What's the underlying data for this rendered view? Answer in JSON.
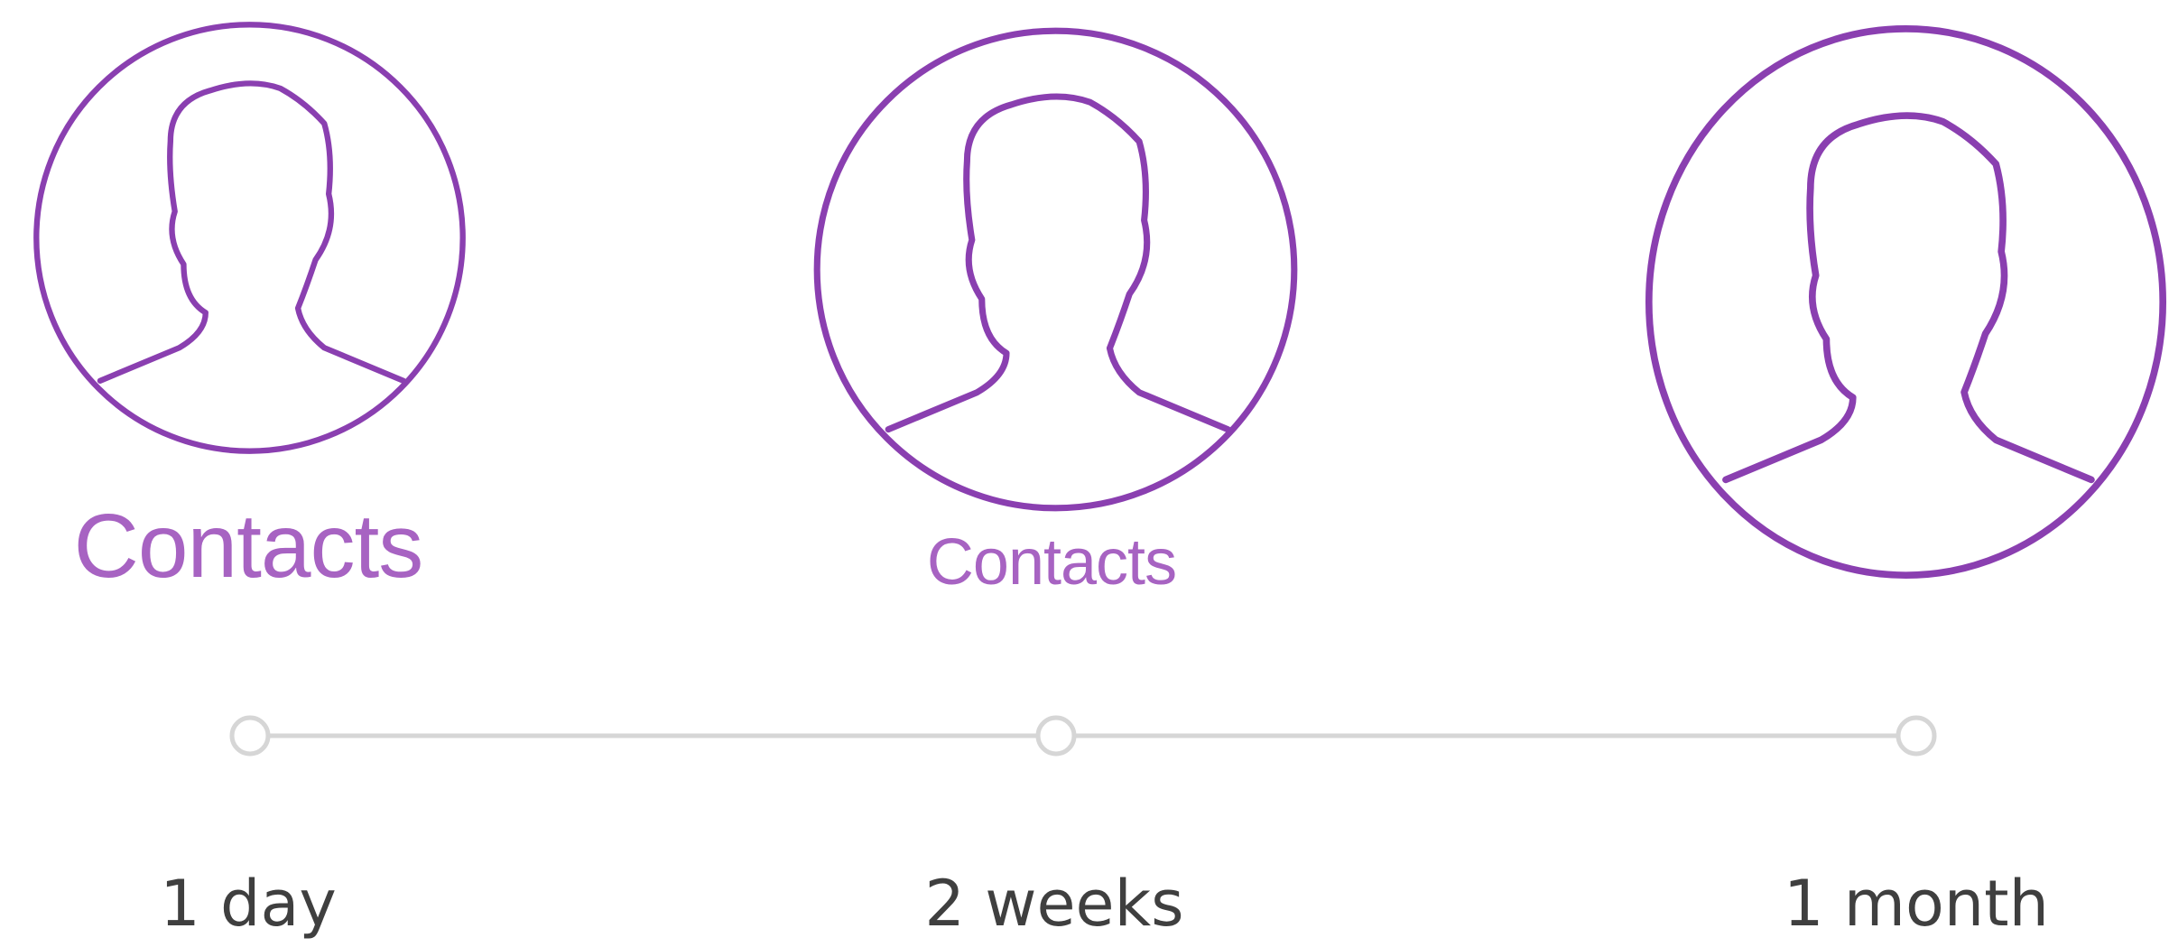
{
  "accent_color": "#8a3fb0",
  "caption_color": "#a763c2",
  "timeline_color": "#d6d6d6",
  "avatars": [
    {
      "icon": "person-icon",
      "caption": "Contacts"
    },
    {
      "icon": "person-icon",
      "caption": "Contacts"
    },
    {
      "icon": "person-icon",
      "caption": ""
    }
  ],
  "timeline": {
    "stops": [
      {
        "label": "1 day"
      },
      {
        "label": "2 weeks"
      },
      {
        "label": "1 month"
      }
    ]
  }
}
